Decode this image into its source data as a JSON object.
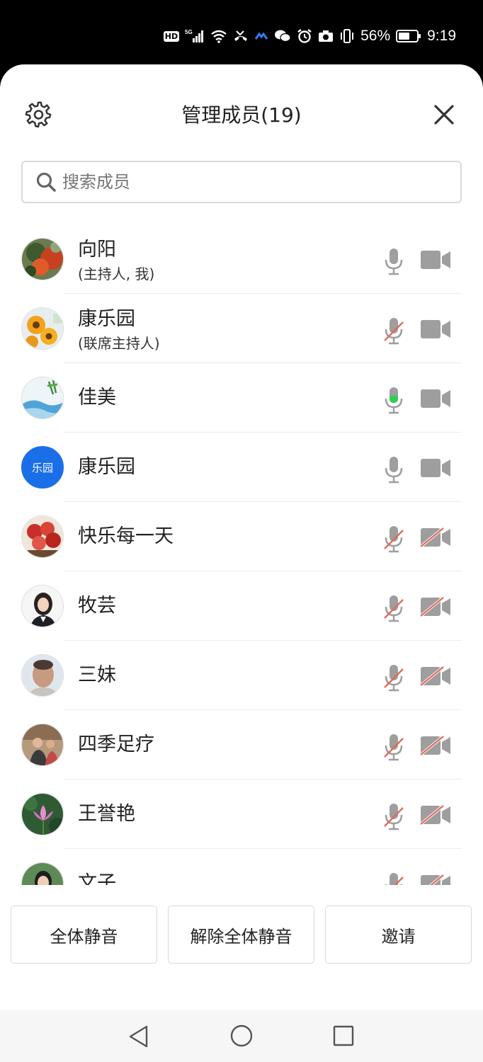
{
  "status_bar": {
    "hd": "HD",
    "signal": "5G",
    "battery": "56%",
    "time": "9:19"
  },
  "header": {
    "title": "管理成员(19)"
  },
  "search": {
    "placeholder": "搜索成员"
  },
  "members": [
    {
      "name": "向阳",
      "role": "(主持人, 我)",
      "avatar": "red-flowers",
      "mic": "on",
      "cam": "on"
    },
    {
      "name": "康乐园",
      "role": "(联席主持人)",
      "avatar": "sunflowers",
      "mic": "muted",
      "cam": "on"
    },
    {
      "name": "佳美",
      "role": "",
      "avatar": "bamboo-water",
      "mic": "speaking",
      "cam": "on"
    },
    {
      "name": "康乐园",
      "role": "",
      "avatar_text": "乐园",
      "avatar": "blue-text",
      "mic": "on",
      "cam": "on"
    },
    {
      "name": "快乐每一天",
      "role": "",
      "avatar": "red-bouquet",
      "mic": "muted",
      "cam": "off"
    },
    {
      "name": "牧芸",
      "role": "",
      "avatar": "woman-portrait",
      "mic": "muted",
      "cam": "off"
    },
    {
      "name": "三妹",
      "role": "",
      "avatar": "person-face",
      "mic": "muted",
      "cam": "off"
    },
    {
      "name": "四季足疗",
      "role": "",
      "avatar": "people-group",
      "mic": "muted",
      "cam": "off"
    },
    {
      "name": "王誉艳",
      "role": "",
      "avatar": "lotus",
      "mic": "muted",
      "cam": "off"
    },
    {
      "name": "文子",
      "role": "",
      "avatar": "woman-portrait-2",
      "mic": "muted",
      "cam": "off"
    }
  ],
  "actions": {
    "mute_all": "全体静音",
    "unmute_all": "解除全体静音",
    "invite": "邀请"
  },
  "colors": {
    "icon_gray": "#9e9e9e",
    "muted_red": "#e06a5a",
    "speaking_green": "#2fcf52",
    "avatar_blue": "#1a6fe8"
  }
}
